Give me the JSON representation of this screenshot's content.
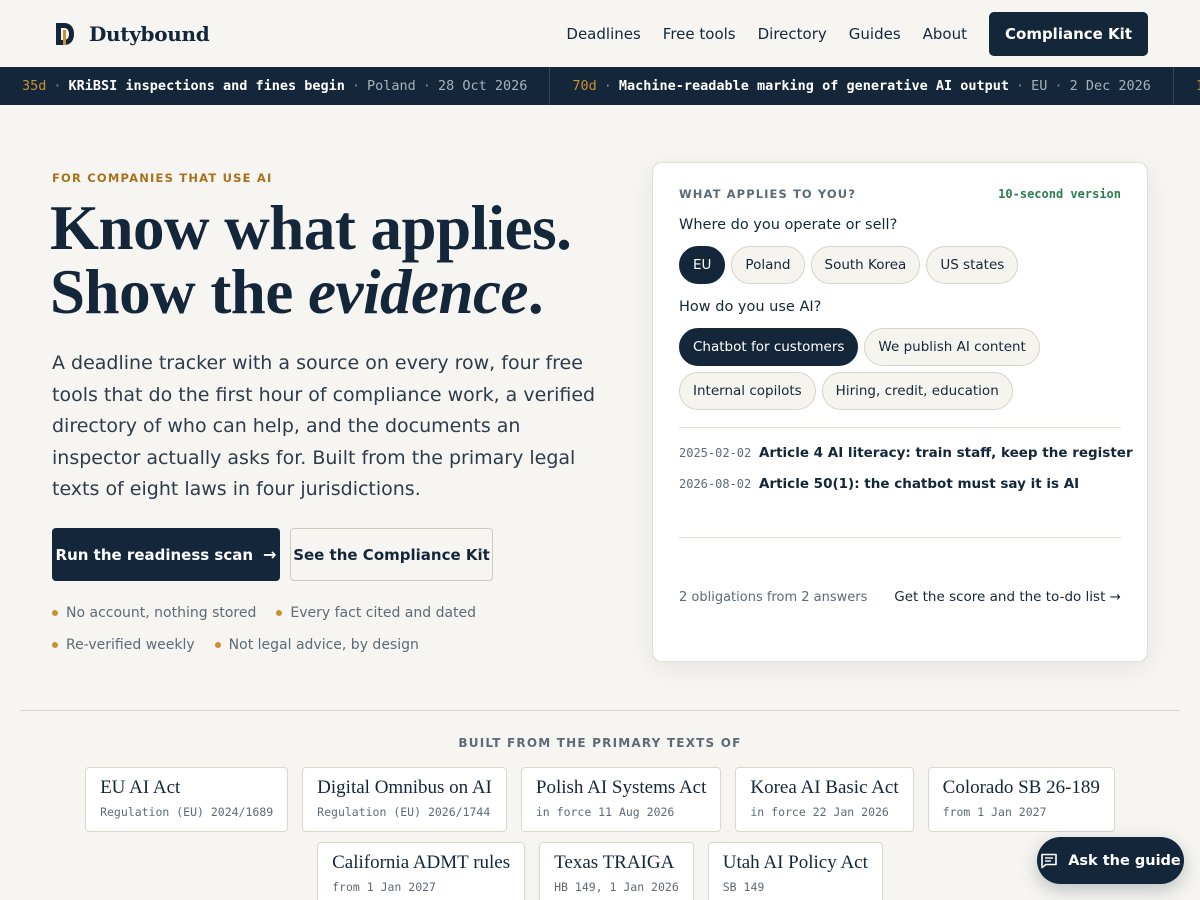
{
  "brand": {
    "name": "Dutybound",
    "logo_icon": "dutybound-logo-icon"
  },
  "nav": {
    "links": [
      "Deadlines",
      "Free tools",
      "Directory",
      "Guides",
      "About"
    ],
    "cta": "Compliance Kit"
  },
  "ticker": [
    {
      "days": "35d",
      "title": "KRiBSI inspections and fines begin",
      "place": "Poland",
      "date": "28 Oct 2026"
    },
    {
      "days": "70d",
      "title": "Machine-readable marking of generative AI output",
      "place": "EU",
      "date": "2 Dec 2026"
    },
    {
      "days": "1",
      "title": "",
      "place": "",
      "date": ""
    }
  ],
  "hero": {
    "eyebrow": "FOR COMPANIES THAT USE AI",
    "headline_line1": "Know what applies.",
    "headline_line2_pre": "Show the ",
    "headline_line2_em": "evidence",
    "headline_line2_post": ".",
    "lede": "A deadline tracker with a source on every row, four free tools that do the first hour of compliance work, a verified directory of who can help, and the documents an inspector actually asks for. Built from the primary legal texts of eight laws in four jurisdictions.",
    "primary_cta": "Run the readiness scan",
    "primary_cta_icon": "arrow-right-icon",
    "secondary_cta": "See the Compliance Kit",
    "trust": [
      "No account, nothing stored",
      "Every fact cited and dated",
      "Re-verified weekly",
      "Not legal advice, by design"
    ]
  },
  "quiz": {
    "eyebrow": "WHAT APPLIES TO YOU?",
    "tag": "10-second version",
    "q1": "Where do you operate or sell?",
    "q1_options": [
      {
        "label": "EU",
        "selected": true
      },
      {
        "label": "Poland",
        "selected": false
      },
      {
        "label": "South Korea",
        "selected": false
      },
      {
        "label": "US states",
        "selected": false
      }
    ],
    "q2": "How do you use AI?",
    "q2_options": [
      {
        "label": "Chatbot for customers",
        "selected": true
      },
      {
        "label": "We publish AI content",
        "selected": false
      },
      {
        "label": "Internal copilots",
        "selected": false
      },
      {
        "label": "Hiring, credit, education",
        "selected": false
      }
    ],
    "results": [
      {
        "date": "2025-02-02",
        "text": "Article 4 AI literacy: train staff, keep the register"
      },
      {
        "date": "2026-08-02",
        "text": "Article 50(1): the chatbot must say it is AI"
      }
    ],
    "summary": "2 obligations from 2 answers",
    "link": "Get the score and the to-do list →"
  },
  "sources": {
    "title": "BUILT FROM THE PRIMARY TEXTS OF",
    "row1": [
      {
        "name": "EU AI Act",
        "sub": "Regulation (EU) 2024/1689"
      },
      {
        "name": "Digital Omnibus on AI",
        "sub": "Regulation (EU) 2026/1744"
      },
      {
        "name": "Polish AI Systems Act",
        "sub": "in force 11 Aug 2026"
      },
      {
        "name": "Korea AI Basic Act",
        "sub": "in force 22 Jan 2026"
      },
      {
        "name": "Colorado SB 26-189",
        "sub": "from 1 Jan 2027"
      }
    ],
    "row2": [
      {
        "name": "California ADMT rules",
        "sub": "from 1 Jan 2027"
      },
      {
        "name": "Texas TRAIGA",
        "sub": "HB 149, 1 Jan 2026"
      },
      {
        "name": "Utah AI Policy Act",
        "sub": "SB 149"
      }
    ]
  },
  "guide_button": {
    "label": "Ask the guide",
    "icon": "chat-icon"
  },
  "colors": {
    "navy": "#14263a",
    "gold": "#c9922e",
    "green": "#2e7d4f",
    "background": "#f6f5f1"
  }
}
